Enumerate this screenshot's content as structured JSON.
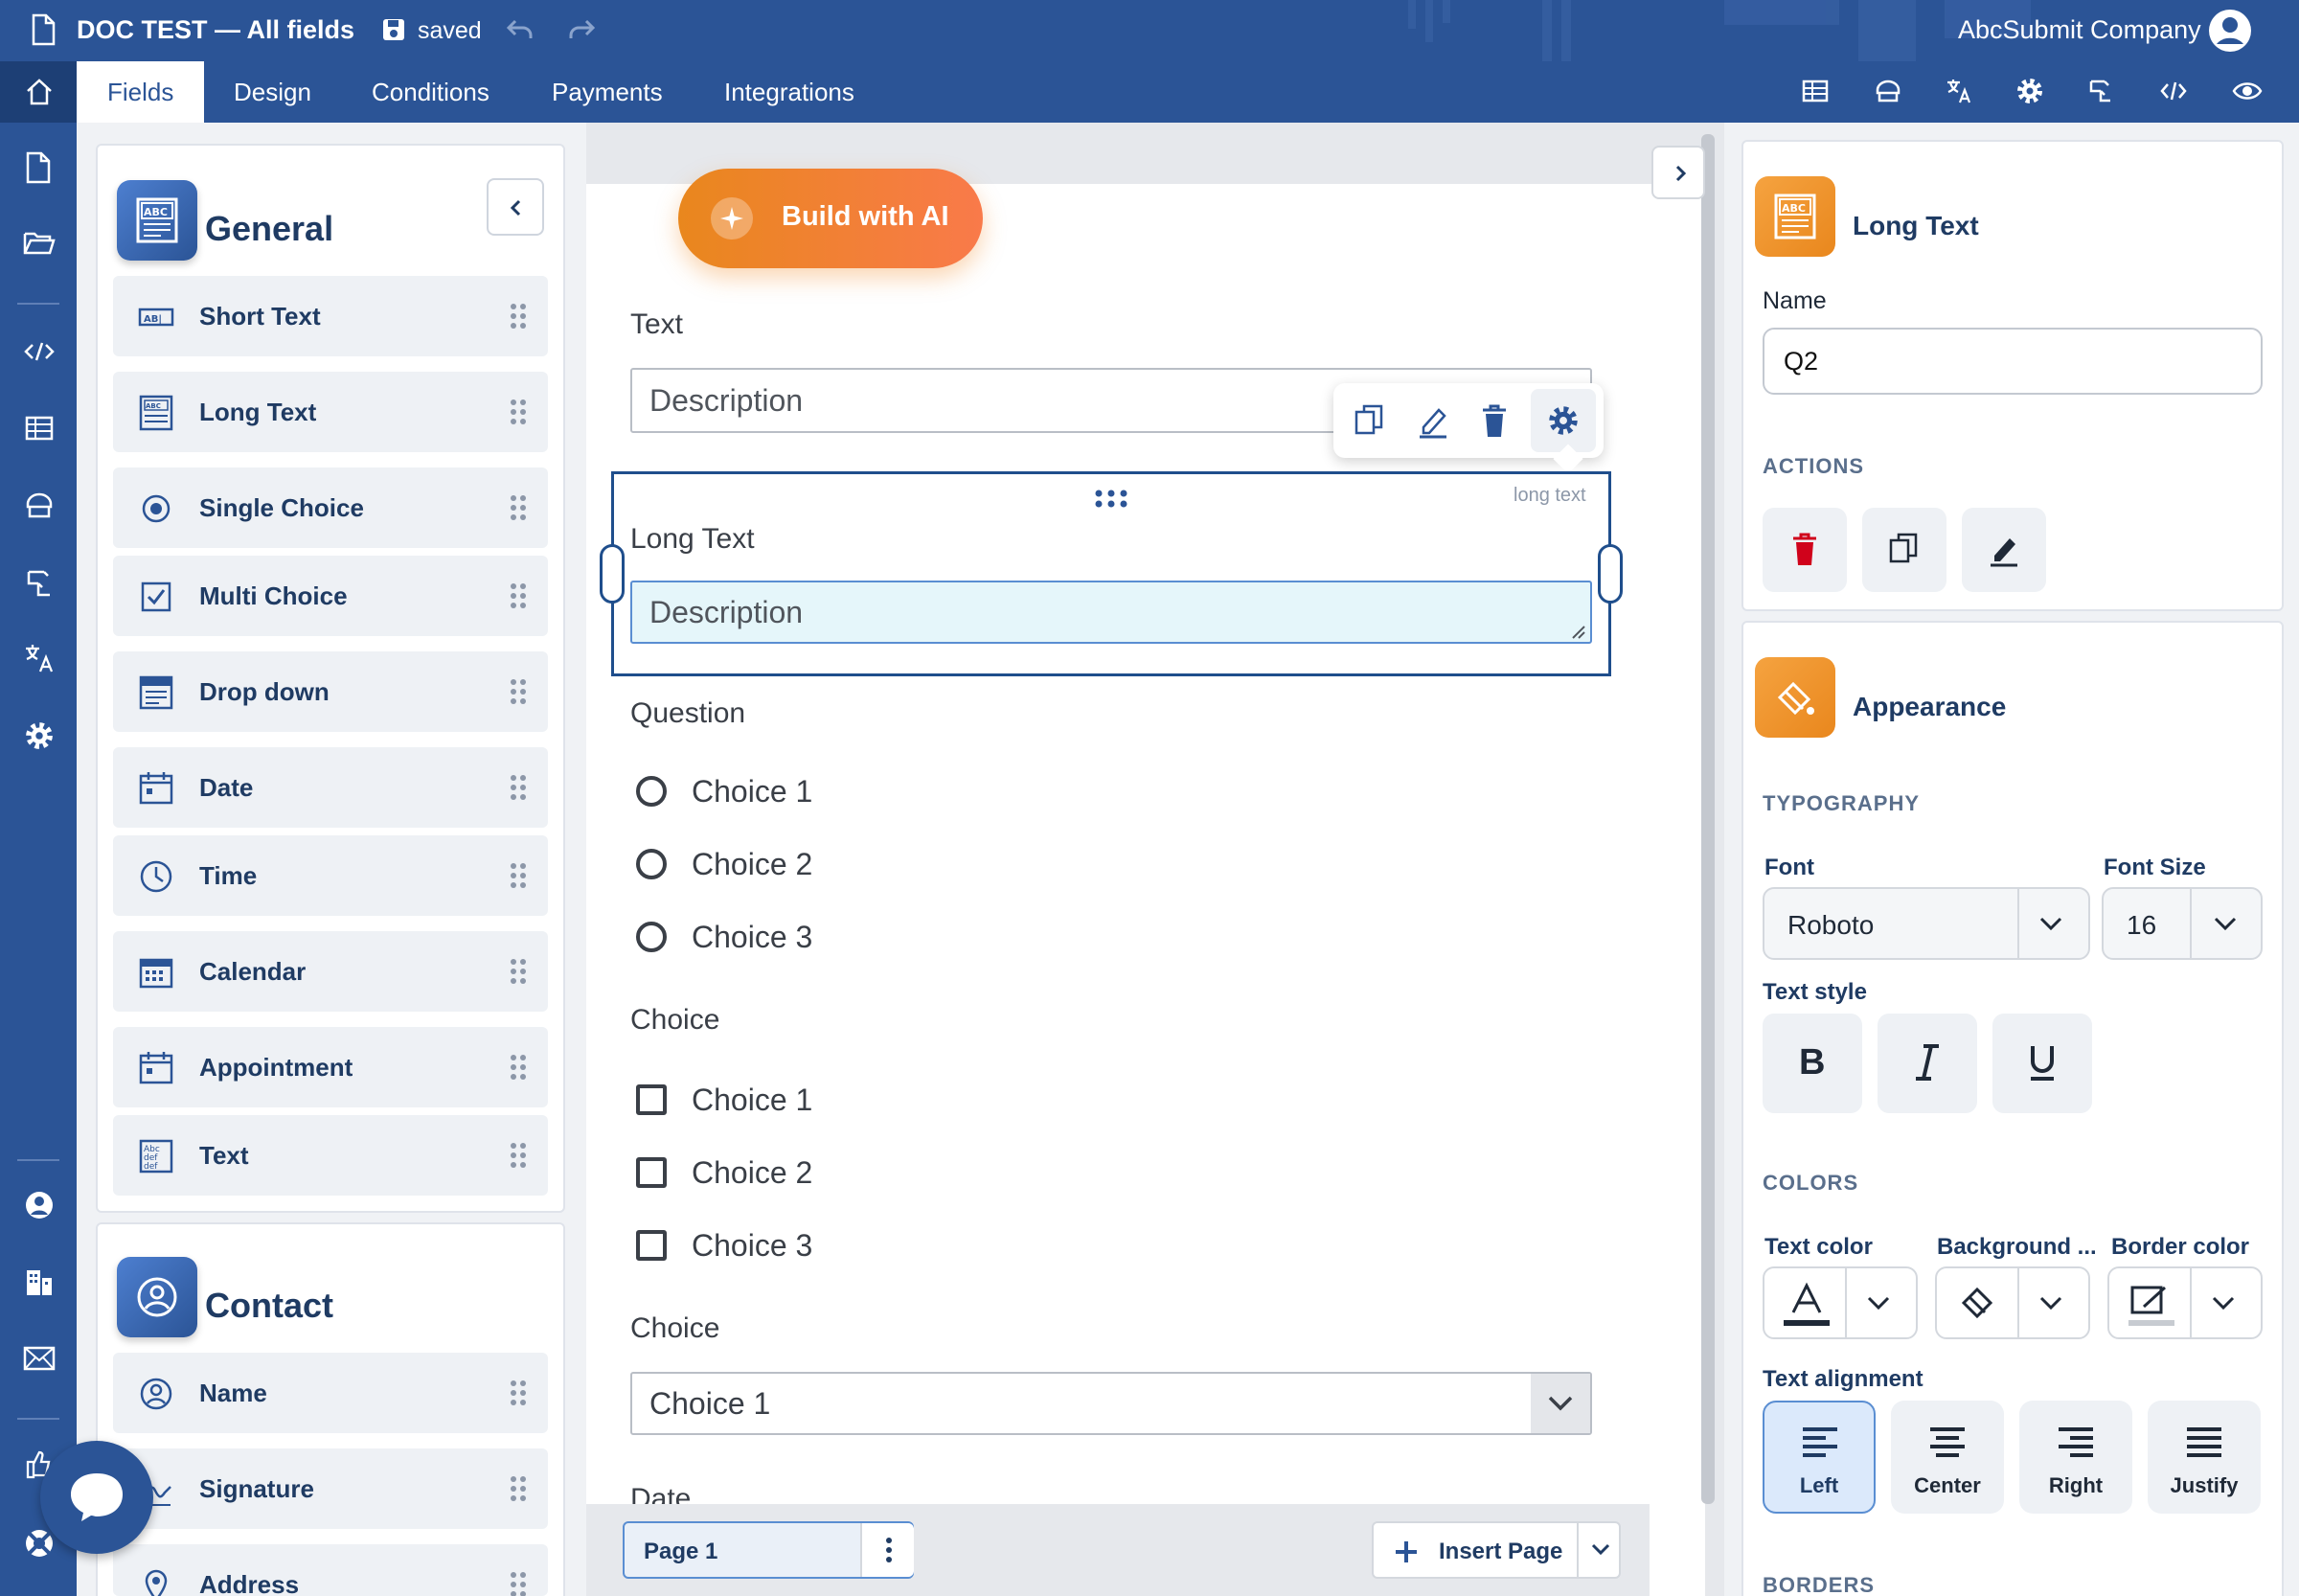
{
  "header": {
    "doc_title": "DOC TEST — All fields",
    "save_status": "saved",
    "company": "AbcSubmit Company"
  },
  "tabs": [
    "Fields",
    "Design",
    "Conditions",
    "Payments",
    "Integrations"
  ],
  "field_panel": {
    "general": {
      "title": "General",
      "items": [
        "Short Text",
        "Long Text",
        "Single Choice",
        "Multi Choice",
        "Drop down",
        "Date",
        "Time",
        "Calendar",
        "Appointment",
        "Text"
      ]
    },
    "contact": {
      "title": "Contact",
      "items": [
        "Name",
        "Signature",
        "Address"
      ]
    }
  },
  "canvas": {
    "build_ai": "Build with AI",
    "text_field": {
      "label": "Text",
      "placeholder": "Description"
    },
    "long_text_field": {
      "label": "Long Text",
      "placeholder": "Description",
      "type_tag": "long text"
    },
    "question": {
      "label": "Question",
      "choices": [
        "Choice 1",
        "Choice 2",
        "Choice 3"
      ]
    },
    "multi": {
      "label": "Choice",
      "choices": [
        "Choice 1",
        "Choice 2",
        "Choice 3"
      ]
    },
    "dropdown": {
      "label": "Choice",
      "value": "Choice 1"
    },
    "next_label": "Date",
    "page_label": "Page 1",
    "insert_page": "Insert Page"
  },
  "props": {
    "title": "Long Text",
    "name_label": "Name",
    "name_value": "Q2",
    "actions_label": "ACTIONS",
    "appearance_title": "Appearance",
    "typography_label": "TYPOGRAPHY",
    "font_label": "Font",
    "font_value": "Roboto",
    "font_size_label": "Font Size",
    "font_size_value": "16",
    "text_style_label": "Text style",
    "colors_label": "COLORS",
    "text_color_label": "Text color",
    "background_label": "Background ...",
    "border_color_label": "Border color",
    "alignment_label": "Text alignment",
    "alignments": [
      "Left",
      "Center",
      "Right",
      "Justify"
    ],
    "borders_label": "BORDERS"
  },
  "colors": {
    "brand": "#2b5496",
    "accent_orange": "#f08a24",
    "selected_field": "#1f4e8c",
    "delete_red": "#d0021b"
  }
}
